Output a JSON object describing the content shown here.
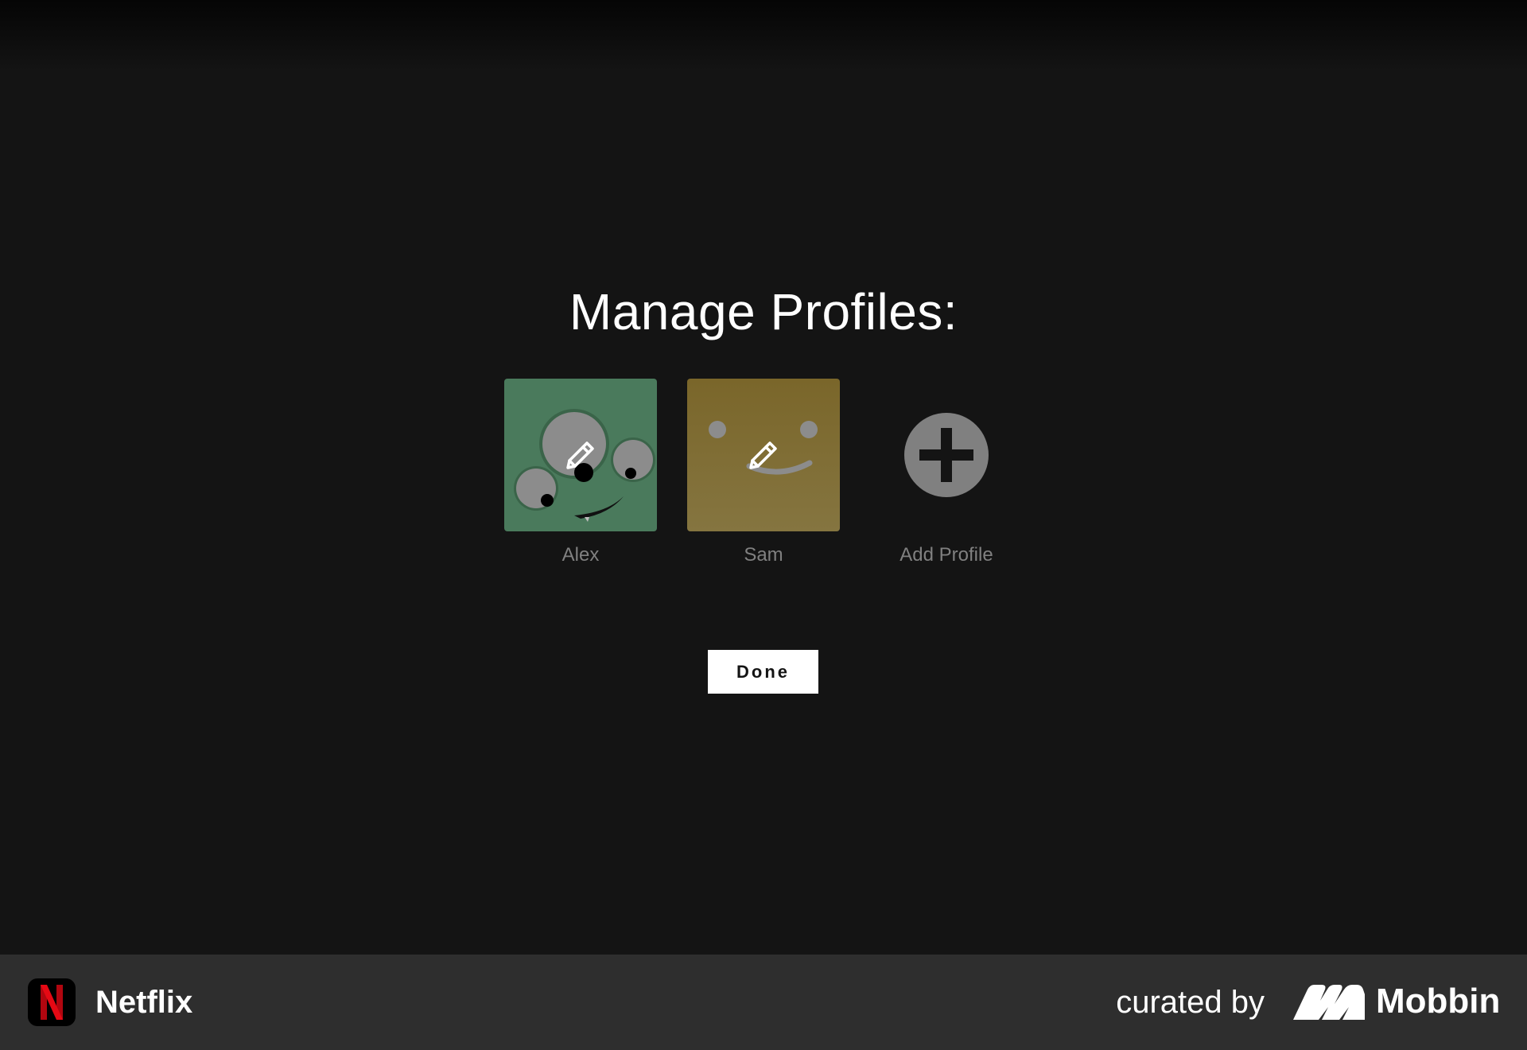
{
  "page": {
    "title": "Manage Profiles:"
  },
  "profiles": [
    {
      "name": "Alex",
      "color": "#4a7a5c",
      "icon": "pencil-icon"
    },
    {
      "name": "Sam",
      "color": "#7e6b2e",
      "icon": "pencil-icon"
    }
  ],
  "add_profile": {
    "label": "Add Profile",
    "icon": "plus-circle-icon"
  },
  "done_button": {
    "label": "Done"
  },
  "footer": {
    "app_name": "Netflix",
    "app_icon": "netflix-n-icon",
    "curated_by": "curated by",
    "brand_name": "Mobbin",
    "brand_icon": "mobbin-logo-icon"
  },
  "colors": {
    "background": "#141414",
    "footer_background": "#2e2e2e",
    "netflix_red": "#e50914",
    "muted_text": "#808080"
  }
}
